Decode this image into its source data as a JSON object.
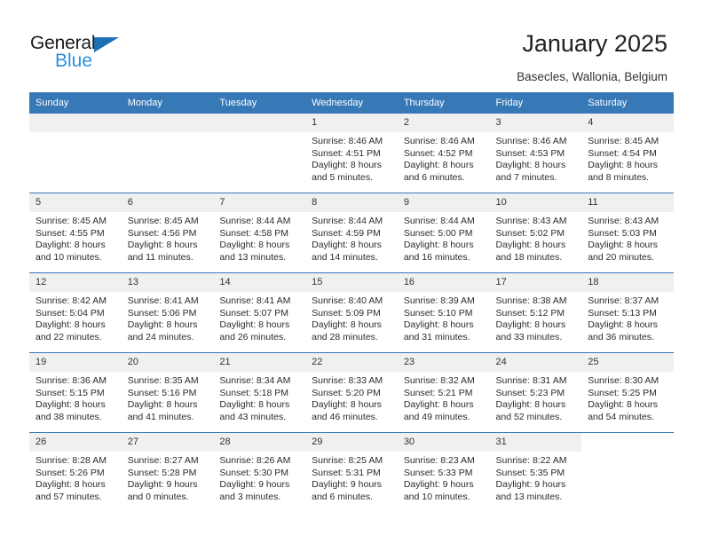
{
  "brand": {
    "name_top": "General",
    "name_bottom": "Blue",
    "accent_color": "#2a90d8",
    "triangle_color": "#1b6fb5"
  },
  "header": {
    "title": "January 2025",
    "subtitle": "Basecles, Wallonia, Belgium"
  },
  "calendar": {
    "header_bg": "#3778b7",
    "daynum_bg": "#f0f0f0",
    "weekday_headers": [
      "Sunday",
      "Monday",
      "Tuesday",
      "Wednesday",
      "Thursday",
      "Friday",
      "Saturday"
    ],
    "weeks": [
      [
        {
          "day": "",
          "empty": true
        },
        {
          "day": "",
          "empty": true
        },
        {
          "day": "",
          "empty": true
        },
        {
          "day": "1",
          "sunrise": "Sunrise: 8:46 AM",
          "sunset": "Sunset: 4:51 PM",
          "daylight_1": "Daylight: 8 hours",
          "daylight_2": "and 5 minutes."
        },
        {
          "day": "2",
          "sunrise": "Sunrise: 8:46 AM",
          "sunset": "Sunset: 4:52 PM",
          "daylight_1": "Daylight: 8 hours",
          "daylight_2": "and 6 minutes."
        },
        {
          "day": "3",
          "sunrise": "Sunrise: 8:46 AM",
          "sunset": "Sunset: 4:53 PM",
          "daylight_1": "Daylight: 8 hours",
          "daylight_2": "and 7 minutes."
        },
        {
          "day": "4",
          "sunrise": "Sunrise: 8:45 AM",
          "sunset": "Sunset: 4:54 PM",
          "daylight_1": "Daylight: 8 hours",
          "daylight_2": "and 8 minutes."
        }
      ],
      [
        {
          "day": "5",
          "sunrise": "Sunrise: 8:45 AM",
          "sunset": "Sunset: 4:55 PM",
          "daylight_1": "Daylight: 8 hours",
          "daylight_2": "and 10 minutes."
        },
        {
          "day": "6",
          "sunrise": "Sunrise: 8:45 AM",
          "sunset": "Sunset: 4:56 PM",
          "daylight_1": "Daylight: 8 hours",
          "daylight_2": "and 11 minutes."
        },
        {
          "day": "7",
          "sunrise": "Sunrise: 8:44 AM",
          "sunset": "Sunset: 4:58 PM",
          "daylight_1": "Daylight: 8 hours",
          "daylight_2": "and 13 minutes."
        },
        {
          "day": "8",
          "sunrise": "Sunrise: 8:44 AM",
          "sunset": "Sunset: 4:59 PM",
          "daylight_1": "Daylight: 8 hours",
          "daylight_2": "and 14 minutes."
        },
        {
          "day": "9",
          "sunrise": "Sunrise: 8:44 AM",
          "sunset": "Sunset: 5:00 PM",
          "daylight_1": "Daylight: 8 hours",
          "daylight_2": "and 16 minutes."
        },
        {
          "day": "10",
          "sunrise": "Sunrise: 8:43 AM",
          "sunset": "Sunset: 5:02 PM",
          "daylight_1": "Daylight: 8 hours",
          "daylight_2": "and 18 minutes."
        },
        {
          "day": "11",
          "sunrise": "Sunrise: 8:43 AM",
          "sunset": "Sunset: 5:03 PM",
          "daylight_1": "Daylight: 8 hours",
          "daylight_2": "and 20 minutes."
        }
      ],
      [
        {
          "day": "12",
          "sunrise": "Sunrise: 8:42 AM",
          "sunset": "Sunset: 5:04 PM",
          "daylight_1": "Daylight: 8 hours",
          "daylight_2": "and 22 minutes."
        },
        {
          "day": "13",
          "sunrise": "Sunrise: 8:41 AM",
          "sunset": "Sunset: 5:06 PM",
          "daylight_1": "Daylight: 8 hours",
          "daylight_2": "and 24 minutes."
        },
        {
          "day": "14",
          "sunrise": "Sunrise: 8:41 AM",
          "sunset": "Sunset: 5:07 PM",
          "daylight_1": "Daylight: 8 hours",
          "daylight_2": "and 26 minutes."
        },
        {
          "day": "15",
          "sunrise": "Sunrise: 8:40 AM",
          "sunset": "Sunset: 5:09 PM",
          "daylight_1": "Daylight: 8 hours",
          "daylight_2": "and 28 minutes."
        },
        {
          "day": "16",
          "sunrise": "Sunrise: 8:39 AM",
          "sunset": "Sunset: 5:10 PM",
          "daylight_1": "Daylight: 8 hours",
          "daylight_2": "and 31 minutes."
        },
        {
          "day": "17",
          "sunrise": "Sunrise: 8:38 AM",
          "sunset": "Sunset: 5:12 PM",
          "daylight_1": "Daylight: 8 hours",
          "daylight_2": "and 33 minutes."
        },
        {
          "day": "18",
          "sunrise": "Sunrise: 8:37 AM",
          "sunset": "Sunset: 5:13 PM",
          "daylight_1": "Daylight: 8 hours",
          "daylight_2": "and 36 minutes."
        }
      ],
      [
        {
          "day": "19",
          "sunrise": "Sunrise: 8:36 AM",
          "sunset": "Sunset: 5:15 PM",
          "daylight_1": "Daylight: 8 hours",
          "daylight_2": "and 38 minutes."
        },
        {
          "day": "20",
          "sunrise": "Sunrise: 8:35 AM",
          "sunset": "Sunset: 5:16 PM",
          "daylight_1": "Daylight: 8 hours",
          "daylight_2": "and 41 minutes."
        },
        {
          "day": "21",
          "sunrise": "Sunrise: 8:34 AM",
          "sunset": "Sunset: 5:18 PM",
          "daylight_1": "Daylight: 8 hours",
          "daylight_2": "and 43 minutes."
        },
        {
          "day": "22",
          "sunrise": "Sunrise: 8:33 AM",
          "sunset": "Sunset: 5:20 PM",
          "daylight_1": "Daylight: 8 hours",
          "daylight_2": "and 46 minutes."
        },
        {
          "day": "23",
          "sunrise": "Sunrise: 8:32 AM",
          "sunset": "Sunset: 5:21 PM",
          "daylight_1": "Daylight: 8 hours",
          "daylight_2": "and 49 minutes."
        },
        {
          "day": "24",
          "sunrise": "Sunrise: 8:31 AM",
          "sunset": "Sunset: 5:23 PM",
          "daylight_1": "Daylight: 8 hours",
          "daylight_2": "and 52 minutes."
        },
        {
          "day": "25",
          "sunrise": "Sunrise: 8:30 AM",
          "sunset": "Sunset: 5:25 PM",
          "daylight_1": "Daylight: 8 hours",
          "daylight_2": "and 54 minutes."
        }
      ],
      [
        {
          "day": "26",
          "sunrise": "Sunrise: 8:28 AM",
          "sunset": "Sunset: 5:26 PM",
          "daylight_1": "Daylight: 8 hours",
          "daylight_2": "and 57 minutes."
        },
        {
          "day": "27",
          "sunrise": "Sunrise: 8:27 AM",
          "sunset": "Sunset: 5:28 PM",
          "daylight_1": "Daylight: 9 hours",
          "daylight_2": "and 0 minutes."
        },
        {
          "day": "28",
          "sunrise": "Sunrise: 8:26 AM",
          "sunset": "Sunset: 5:30 PM",
          "daylight_1": "Daylight: 9 hours",
          "daylight_2": "and 3 minutes."
        },
        {
          "day": "29",
          "sunrise": "Sunrise: 8:25 AM",
          "sunset": "Sunset: 5:31 PM",
          "daylight_1": "Daylight: 9 hours",
          "daylight_2": "and 6 minutes."
        },
        {
          "day": "30",
          "sunrise": "Sunrise: 8:23 AM",
          "sunset": "Sunset: 5:33 PM",
          "daylight_1": "Daylight: 9 hours",
          "daylight_2": "and 10 minutes."
        },
        {
          "day": "31",
          "sunrise": "Sunrise: 8:22 AM",
          "sunset": "Sunset: 5:35 PM",
          "daylight_1": "Daylight: 9 hours",
          "daylight_2": "and 13 minutes."
        },
        {
          "day": "",
          "blank": true
        }
      ]
    ]
  }
}
